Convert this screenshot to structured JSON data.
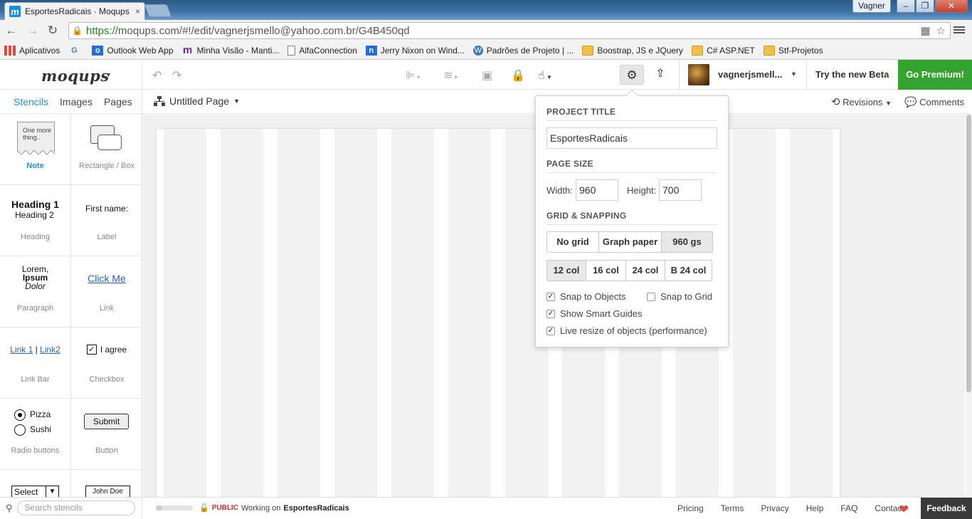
{
  "browser": {
    "tab_title": "EsportesRadicais · Moqups",
    "tab_close": "×",
    "user_chip": "Vagner",
    "url_scheme": "https://",
    "url_rest": "moqups.com/#!/edit/vagnerjsmello@yahoo.com.br/G4B450qd",
    "bookmarks": [
      {
        "label": "Aplicativos",
        "icon": "apps-icon"
      },
      {
        "label": "",
        "icon": "google-icon"
      },
      {
        "label": "Outlook Web App",
        "icon": "outlook-icon"
      },
      {
        "label": "Minha Visão - Manti...",
        "icon": "mantis-icon"
      },
      {
        "label": "AlfaConnection",
        "icon": "document-icon"
      },
      {
        "label": "Jerry Nixon on Wind...",
        "icon": "ms-icon"
      },
      {
        "label": "Padrões de Projeto | ...",
        "icon": "wordpress-icon"
      },
      {
        "label": "Boostrap, JS e JQuery",
        "icon": "folder-icon"
      },
      {
        "label": "C# ASP.NET",
        "icon": "folder-icon"
      },
      {
        "label": "Stf-Projetos",
        "icon": "folder-icon"
      }
    ]
  },
  "app": {
    "logo": "moqups",
    "username": "vagnerjsmell...",
    "beta_link": "Try the new Beta",
    "premium_button": "Go Premium!"
  },
  "subbar": {
    "tabs": [
      "Stencils",
      "Images",
      "Pages"
    ],
    "active_tab": "Stencils",
    "page_name": "Untitled Page",
    "revisions": "Revisions",
    "comments": "Comments"
  },
  "stencils": [
    {
      "name": "Note",
      "preview": "One more thing..",
      "selected": true
    },
    {
      "name": "Rectangle / Box",
      "preview": ""
    },
    {
      "name": "Heading",
      "preview_h1": "Heading 1",
      "preview_h2": "Heading 2"
    },
    {
      "name": "Label",
      "preview": "First name:"
    },
    {
      "name": "Paragraph",
      "preview_1": "Lorem,",
      "preview_2": "Ipsum",
      "preview_3": "Dolor"
    },
    {
      "name": "Link",
      "preview": "Click Me"
    },
    {
      "name": "Link Bar",
      "preview_1": "Link 1",
      "preview_sep": "|",
      "preview_2": "Link2"
    },
    {
      "name": "Checkbox",
      "preview": "I agree"
    },
    {
      "name": "Radio buttons",
      "preview_1": "Pizza",
      "preview_2": "Sushi"
    },
    {
      "name": "Button",
      "preview": "Submit"
    },
    {
      "name": "",
      "preview": "Select"
    },
    {
      "name": "",
      "preview": "John Doe"
    }
  ],
  "settings": {
    "project_title_label": "PROJECT TITLE",
    "project_title_value": "EsportesRadicais",
    "page_size_label": "PAGE SIZE",
    "width_label": "Width:",
    "width_value": "960",
    "height_label": "Height:",
    "height_value": "700",
    "grid_label": "GRID & SNAPPING",
    "grid_options": [
      "No grid",
      "Graph paper",
      "960 gs"
    ],
    "grid_selected": "960 gs",
    "col_options": [
      "12 col",
      "16 col",
      "24 col",
      "B 24 col"
    ],
    "col_selected": "12 col",
    "snap_objects": "Snap to Objects",
    "snap_grid": "Snap to Grid",
    "smart_guides": "Show Smart Guides",
    "live_resize": "Live resize of objects (performance)"
  },
  "bottom": {
    "search_placeholder": "Search stencils",
    "public_label": "PUBLIC",
    "working_on": "Working on",
    "project_name": "EsportesRadicais",
    "footer_links": [
      "Pricing",
      "Terms",
      "Privacy",
      "Help",
      "FAQ",
      "Contact"
    ],
    "feedback": "Feedback"
  },
  "colors": {
    "accent": "#2a8fd0",
    "premium": "#35a32f",
    "public": "#d03030"
  }
}
